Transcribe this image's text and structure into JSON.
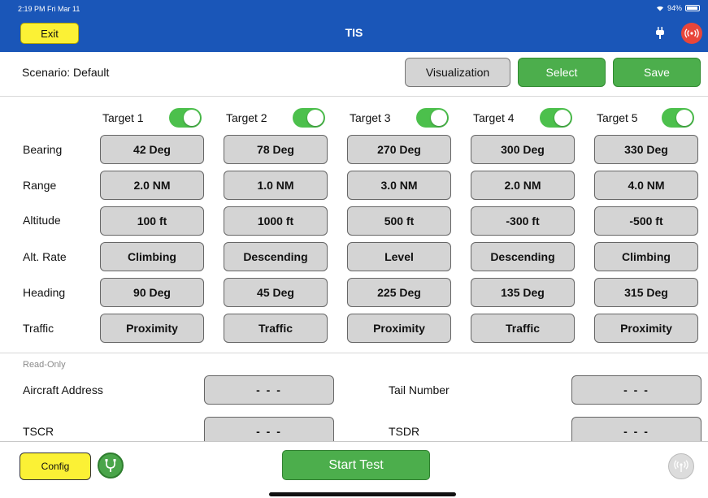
{
  "status": {
    "time": "2:19 PM  Fri Mar 11",
    "battery": "94%"
  },
  "nav": {
    "exit_label": "Exit",
    "title": "TIS",
    "plug_icon": "plug-icon",
    "broadcast_icon": "broadcast-icon"
  },
  "scenario": {
    "label": "Scenario: Default",
    "visualization_label": "Visualization",
    "select_label": "Select",
    "save_label": "Save"
  },
  "targets": [
    {
      "label": "Target 1",
      "enabled": true
    },
    {
      "label": "Target 2",
      "enabled": true
    },
    {
      "label": "Target 3",
      "enabled": true
    },
    {
      "label": "Target 4",
      "enabled": true
    },
    {
      "label": "Target 5",
      "enabled": true
    }
  ],
  "rows": [
    {
      "label": "Bearing",
      "values": [
        "42 Deg",
        "78 Deg",
        "270 Deg",
        "300 Deg",
        "330 Deg"
      ]
    },
    {
      "label": "Range",
      "values": [
        "2.0 NM",
        "1.0 NM",
        "3.0 NM",
        "2.0 NM",
        "4.0 NM"
      ]
    },
    {
      "label": "Altitude",
      "values": [
        "100 ft",
        "1000 ft",
        "500 ft",
        "-300 ft",
        "-500 ft"
      ]
    },
    {
      "label": "Alt. Rate",
      "values": [
        "Climbing",
        "Descending",
        "Level",
        "Descending",
        "Climbing"
      ]
    },
    {
      "label": "Heading",
      "values": [
        "90 Deg",
        "45 Deg",
        "225 Deg",
        "135 Deg",
        "315 Deg"
      ]
    },
    {
      "label": "Traffic",
      "values": [
        "Proximity",
        "Traffic",
        "Proximity",
        "Traffic",
        "Proximity"
      ]
    }
  ],
  "readonly": {
    "title": "Read-Only",
    "aircraft_address_label": "Aircraft Address",
    "aircraft_address_value": "- - -",
    "tail_number_label": "Tail Number",
    "tail_number_value": "- - -",
    "tscr_label": "TSCR",
    "tscr_value": "- - -",
    "tsdr_label": "TSDR",
    "tsdr_value": "- - -"
  },
  "bottom": {
    "config_label": "Config",
    "start_label": "Start Test"
  },
  "colors": {
    "nav_blue": "#1a56b8",
    "accent_green": "#4cae4c",
    "exit_yellow": "#fbf135",
    "toggle_green": "#4cc04c",
    "alert_red": "#e8463a"
  }
}
